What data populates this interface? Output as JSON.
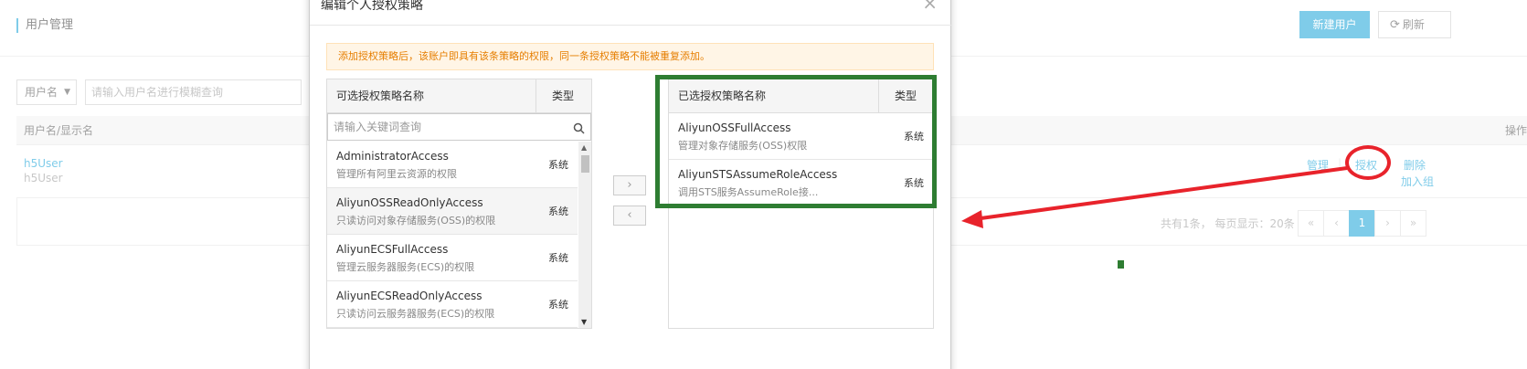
{
  "page": {
    "title": "用户管理",
    "new_user_label": "新建用户",
    "refresh_label": "刷新",
    "search": {
      "select_value": "用户名",
      "placeholder": "请输入用户名进行模糊查询"
    },
    "table": {
      "col_user": "用户名/显示名",
      "col_ops": "操作",
      "rows": [
        {
          "username": "h5User",
          "display_name": "h5User",
          "ops": {
            "manage": "管理",
            "separator": "|",
            "authorize": "授权",
            "delete": "删除",
            "add_group": "加入组"
          }
        }
      ]
    },
    "pagination": {
      "info": "共有1条， 每页显示：20条",
      "first": "«",
      "prev": "‹",
      "current": "1",
      "next": "›",
      "last": "»"
    }
  },
  "modal": {
    "title": "编辑个人授权策略",
    "close_icon": "×",
    "warning": "添加授权策略后，该账户即具有该条策略的权限，同一条授权策略不能被重复添加。",
    "available": {
      "header_name": "可选授权策略名称",
      "header_type": "类型",
      "search_placeholder": "请输入关键词查询",
      "search_icon": "⚲",
      "items": [
        {
          "name": "AdministratorAccess",
          "desc": "管理所有阿里云资源的权限",
          "type": "系统"
        },
        {
          "name": "AliyunOSSReadOnlyAccess",
          "desc": "只读访问对象存储服务(OSS)的权限",
          "type": "系统"
        },
        {
          "name": "AliyunECSFullAccess",
          "desc": "管理云服务器服务(ECS)的权限",
          "type": "系统"
        },
        {
          "name": "AliyunECSReadOnlyAccess",
          "desc": "只读访问云服务器服务(ECS)的权限",
          "type": "系统"
        }
      ],
      "scroll_up": "▲",
      "scroll_down": "▼"
    },
    "move_right": "›",
    "move_left": "‹",
    "selected": {
      "header_name": "已选授权策略名称",
      "header_type": "类型",
      "items": [
        {
          "name": "AliyunOSSFullAccess",
          "desc": "管理对象存储服务(OSS)权限",
          "type": "系统"
        },
        {
          "name": "AliyunSTSAssumeRoleAccess",
          "desc": "调用STS服务AssumeRole接...",
          "type": "系统"
        }
      ]
    }
  },
  "colors": {
    "accent": "#17a2d8",
    "annotation_red": "#e8232b",
    "annotation_green": "#2e7d32",
    "warning_text": "#e67e00"
  }
}
